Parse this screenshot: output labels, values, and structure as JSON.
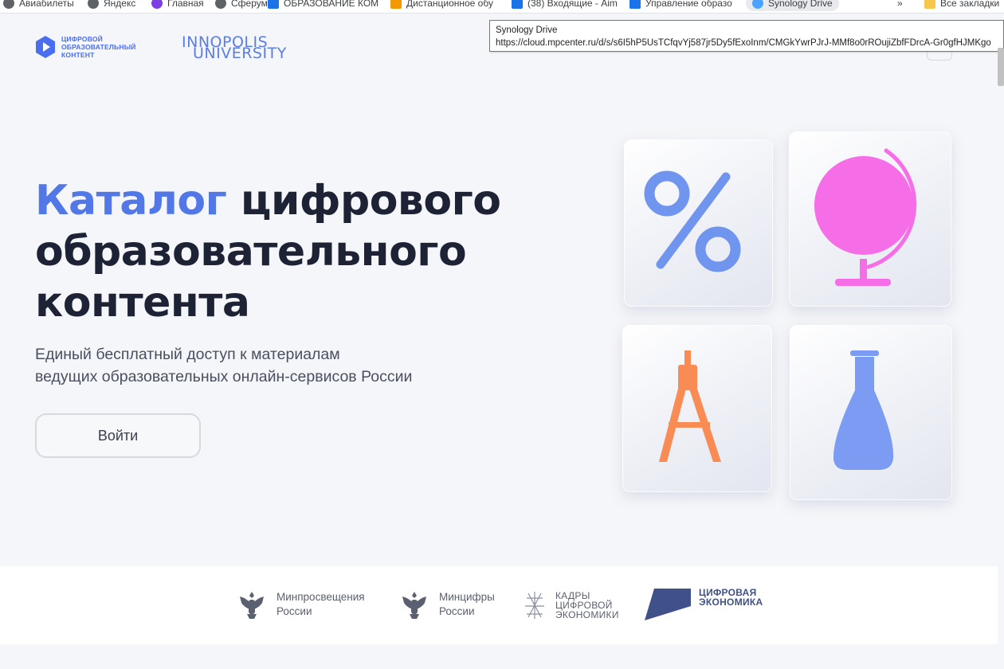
{
  "bookmarks": [
    {
      "label": "Авиабилеты"
    },
    {
      "label": "Яндекс"
    },
    {
      "label": "Главная"
    },
    {
      "label": "Сферум"
    },
    {
      "label": "ОБРАЗОВАНИЕ КОМ"
    },
    {
      "label": "Дистанционное обу"
    },
    {
      "label": "(38) Входящие - Aim"
    },
    {
      "label": "Управление образо"
    },
    {
      "label": "Synology Drive"
    },
    {
      "label": "Все закладки"
    }
  ],
  "tooltip": {
    "title": "Synology Drive",
    "url": "https://cloud.mpcenter.ru/d/s/s6I5hP5UsTCfqvYj587jr5Dy5fExoInm/CMGkYwrPJrJ-MMf8o0rROujiZbfFDrcA-Gr0gfHJMKgo"
  },
  "header": {
    "brand_line1": "ЦИФРОВОЙ",
    "brand_line2": "ОБРАЗОВАТЕЛЬНЫЙ",
    "brand_line3": "КОНТЕНТ",
    "partner_logo_line1": "INNOPOLIS",
    "partner_logo_line2": "UNIVERSITY"
  },
  "hero": {
    "title_accent": "Каталог",
    "title_rest": " цифрового образовательного контента",
    "subtitle_line1": "Единый бесплатный доступ к материалам",
    "subtitle_line2": "ведущих образовательных онлайн-сервисов России",
    "login_label": "Войти"
  },
  "tiles": {
    "percent_color": "#6f95ee",
    "globe_color": "#f56ee8",
    "compass_color": "#f98b54",
    "flask_color": "#7b9cf2"
  },
  "partners": [
    {
      "name": "Минпросвещения\nРоссии"
    },
    {
      "name": "Минцифры\nРоссии"
    },
    {
      "name": "КАДРЫ\nЦИФРОВОЙ\nЭКОНОМИКИ"
    },
    {
      "name": "ЦИФРОВАЯ\nЭКОНОМИКА"
    }
  ]
}
